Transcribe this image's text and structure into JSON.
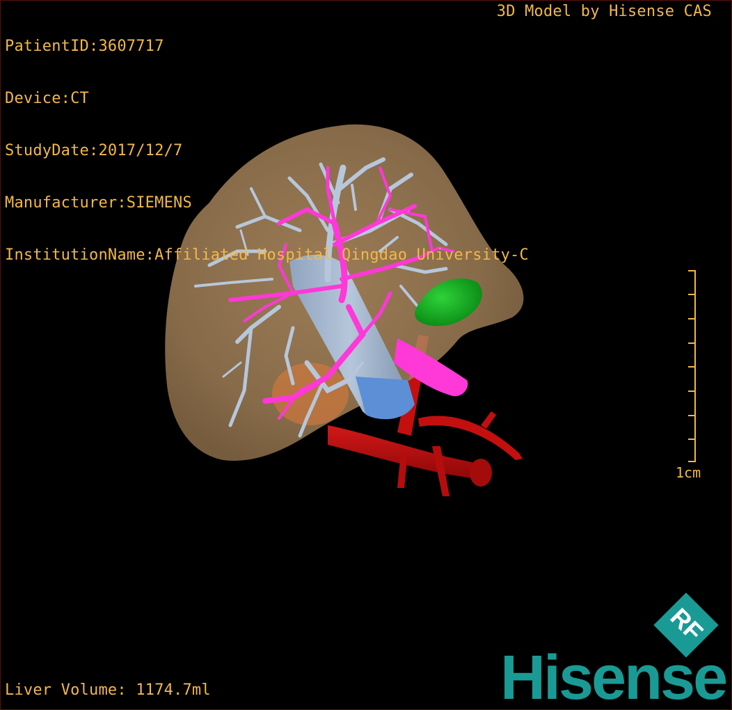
{
  "info": {
    "patient_id": "PatientID:3607717",
    "device": "Device:CT",
    "study_date": "StudyDate:2017/12/7",
    "manufacturer": "Manufacturer:SIEMENS",
    "institution": "InstitutionName:Affiliated Hospital Qingdao University-C"
  },
  "credit": "3D Model by Hisense CAS",
  "liver_volume": "Liver Volume: 1174.7ml",
  "scale_label": "1cm",
  "logo": {
    "badge_text": "RF",
    "brand": "Hisense"
  },
  "colors": {
    "overlay_text": "#f2b84a",
    "liver": "#a5835a",
    "hepatic_vein": "#b7c7db",
    "portal_vein": "#ff38d8",
    "artery": "#c40f0f",
    "gallbladder": "#0fb01f",
    "brand": "#1a9a95"
  }
}
